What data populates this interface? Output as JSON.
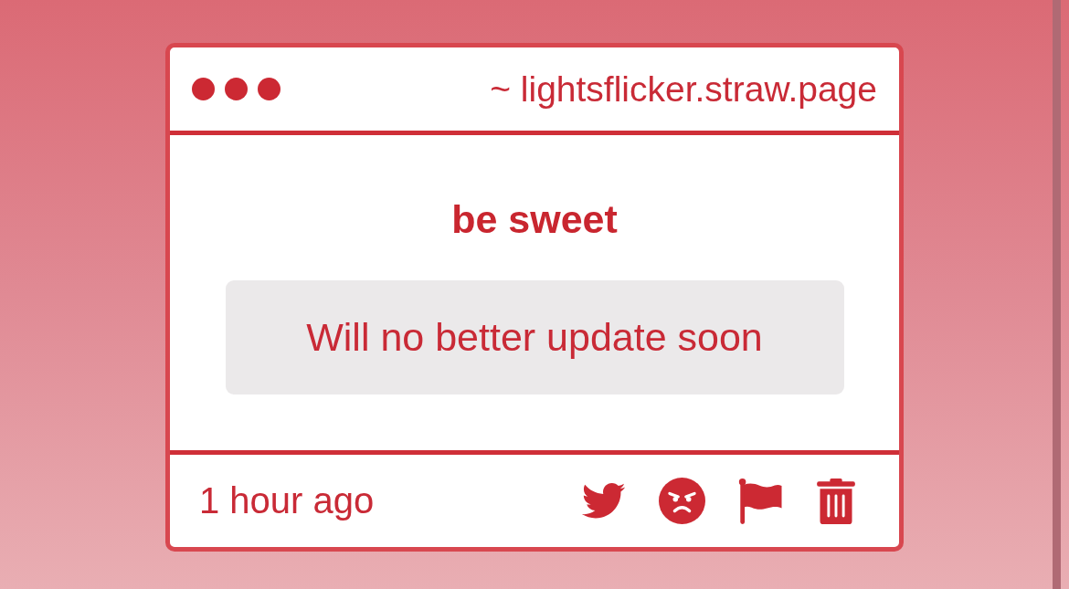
{
  "header": {
    "address": "~ lightsflicker.straw.page"
  },
  "message": {
    "title": "be sweet",
    "body": "Will no better update soon"
  },
  "footer": {
    "time": "1 hour ago",
    "actions": [
      {
        "kind": "tweet"
      },
      {
        "kind": "angry"
      },
      {
        "kind": "flag"
      },
      {
        "kind": "delete"
      }
    ]
  }
}
